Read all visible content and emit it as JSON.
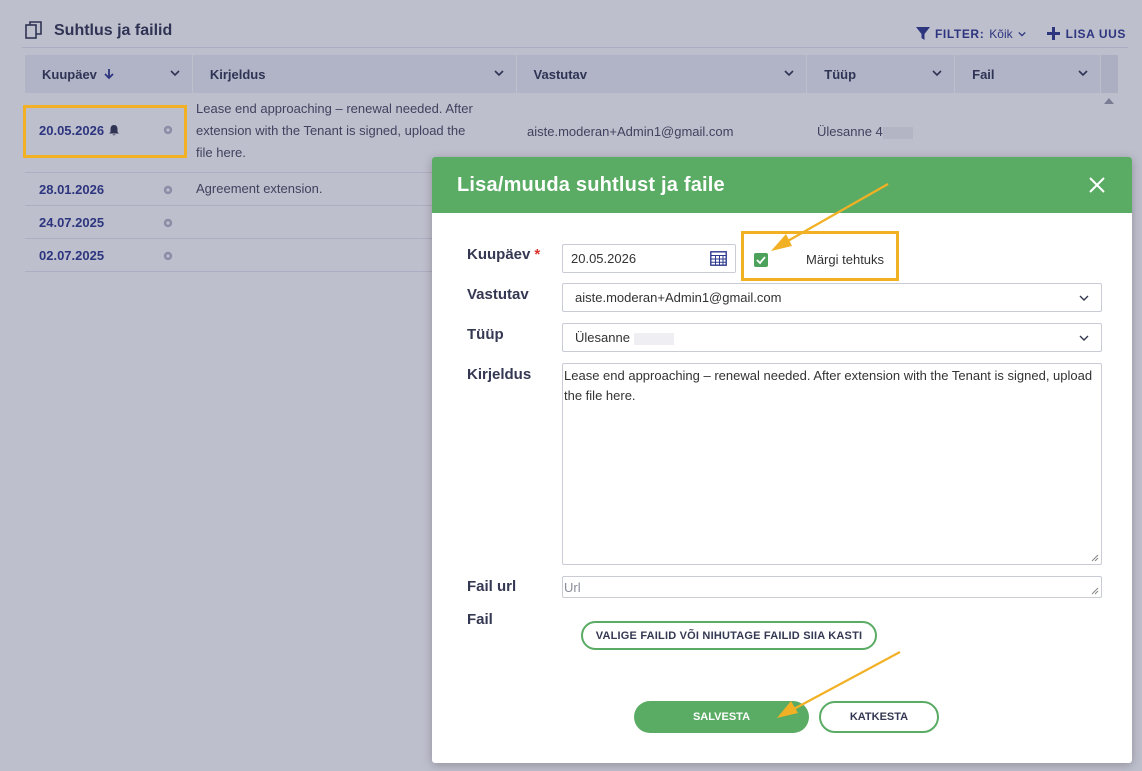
{
  "header": {
    "title": "Suhtlus ja failid",
    "filter_label": "FILTER:",
    "filter_value": "Kõik",
    "add_label": "LISA UUS"
  },
  "table": {
    "columns": [
      "Kuupäev",
      "Kirjeldus",
      "Vastutav",
      "Tüüp",
      "Fail"
    ],
    "rows": [
      {
        "date": "20.05.2026",
        "description_lines": [
          "Lease end approaching – renewal needed. After",
          "extension with the Tenant is signed, upload the",
          "file here."
        ],
        "responsible": "aiste.moderan+Admin1@gmail.com",
        "type": "Ülesanne 4"
      },
      {
        "date": "28.01.2026",
        "description": "Agreement extension."
      },
      {
        "date": "24.07.2025",
        "description": ""
      },
      {
        "date": "02.07.2025",
        "description": ""
      }
    ]
  },
  "modal": {
    "title": "Lisa/muuda suhtlust ja faile",
    "date_label": "Kuupäev",
    "required_mark": "*",
    "date_value": "20.05.2026",
    "done_label": "Märgi tehtuks",
    "done_checked": true,
    "responsible_label": "Vastutav",
    "responsible_value": "aiste.moderan+Admin1@gmail.com",
    "type_label": "Tüüp",
    "type_value": "Ülesanne",
    "description_label": "Kirjeldus",
    "description_value": "Lease end approaching – renewal needed. After extension with the Tenant is signed, upload the file here.",
    "file_url_label": "Fail url",
    "file_url_placeholder": "Url",
    "file_label": "Fail",
    "upload_button": "VALIGE FAILID VÕI NIHUTAGE FAILID SIIA KASTI",
    "save_button": "SALVESTA",
    "cancel_button": "KATKESTA"
  },
  "colors": {
    "accent_green": "#5aab64",
    "link_blue": "#2f3a8f",
    "highlight_orange": "#f2b024",
    "required_red": "#d9342b"
  },
  "icons": [
    "copy-icon",
    "filter-icon",
    "plus-icon",
    "arrow-down-icon",
    "chevron-down-icon",
    "bell-icon",
    "gear-icon",
    "close-icon",
    "calendar-icon",
    "check-icon"
  ]
}
